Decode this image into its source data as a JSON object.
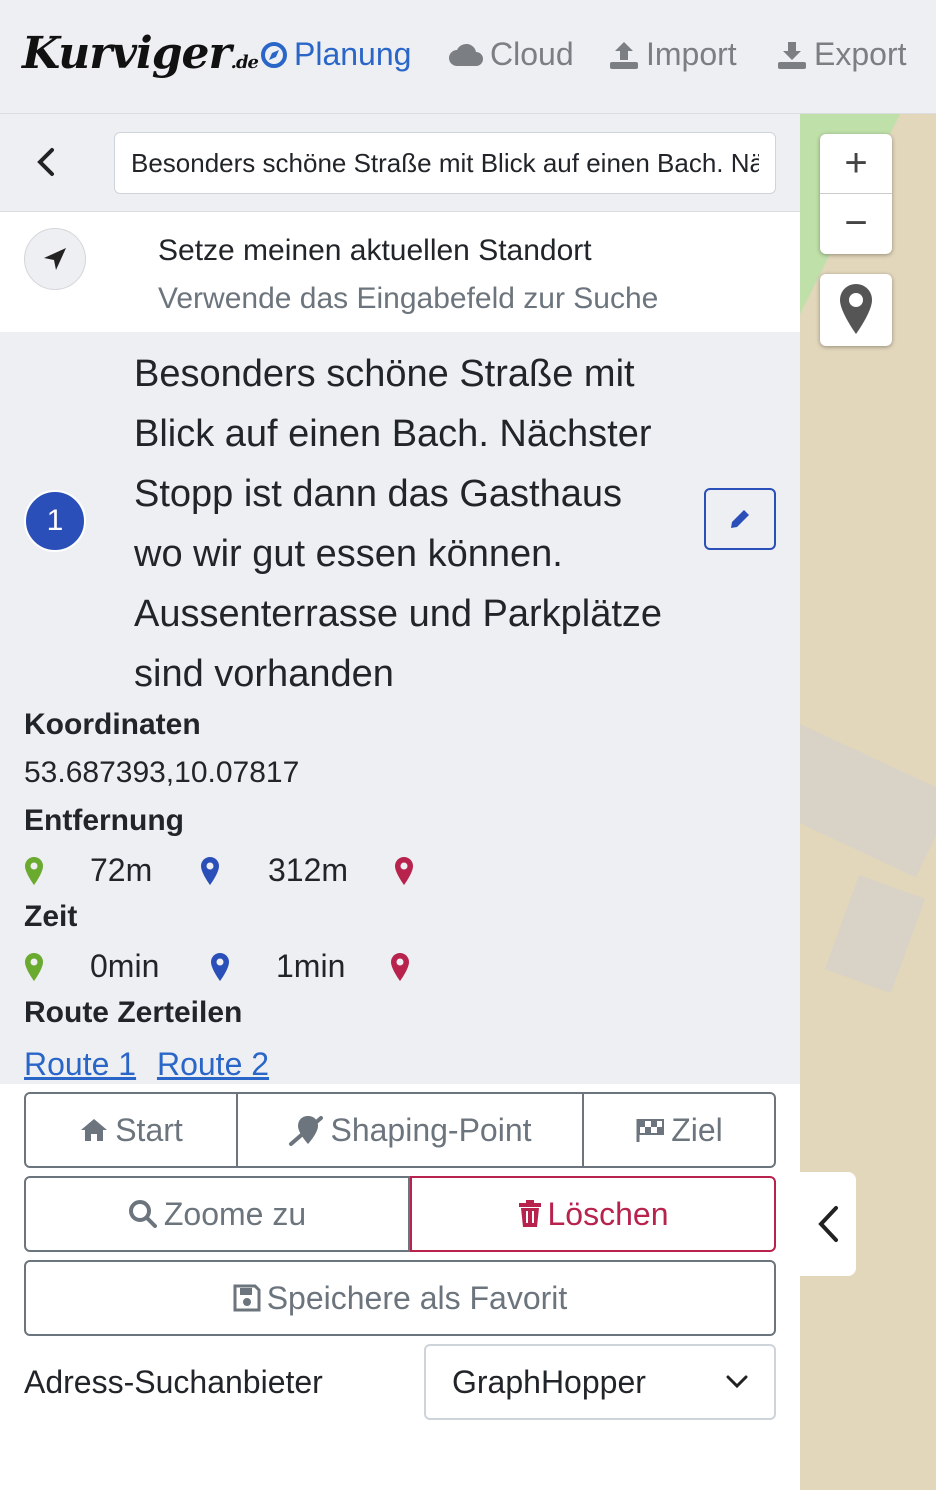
{
  "header": {
    "logo_text": "Kurviger",
    "logo_suffix": ".de",
    "nav": [
      {
        "label": "Planung",
        "icon": "compass-icon",
        "active": true
      },
      {
        "label": "Cloud",
        "icon": "cloud-icon",
        "active": false
      },
      {
        "label": "Import",
        "icon": "upload-icon",
        "active": false
      },
      {
        "label": "Export",
        "icon": "download-icon",
        "active": false
      }
    ]
  },
  "search": {
    "value": "Besonders schöne Straße mit Blick auf einen Bach. Nächster Stopp ist dann das Gasthaus"
  },
  "suggestion": {
    "title": "Setze meinen aktuellen Standort",
    "hint": "Verwende das Eingabefeld zur Suche"
  },
  "waypoint": {
    "number": "1",
    "description": "Besonders schöne Straße mit Blick auf einen Bach. Nächster Stopp ist dann das Gasthaus wo wir gut essen können. Aussenterrasse und Parkplätze sind vorhanden",
    "coord_label": "Koordinaten",
    "coords": "53.687393,10.07817",
    "distance_label": "Entfernung",
    "distance_prev": "72m",
    "distance_next": "312m",
    "time_label": "Zeit",
    "time_prev": "0min",
    "time_next": "1min",
    "split_label": "Route Zerteilen",
    "split_links": [
      "Route 1",
      "Route 2"
    ]
  },
  "buttons": {
    "start": "Start",
    "shaping": "Shaping-Point",
    "ziel": "Ziel",
    "zoom": "Zoome zu",
    "delete": "Löschen",
    "favorite": "Speichere als Favorit"
  },
  "provider": {
    "label": "Adress-Suchanbieter",
    "selected": "GraphHopper"
  },
  "map": {
    "zoom_in": "+",
    "zoom_out": "−"
  },
  "colors": {
    "accent": "#2a66c8",
    "waypoint": "#2a4fb8",
    "danger": "#b8234e",
    "pin_green": "#6aaa2e",
    "pin_blue": "#2a4fb8",
    "pin_red": "#b8234e"
  }
}
